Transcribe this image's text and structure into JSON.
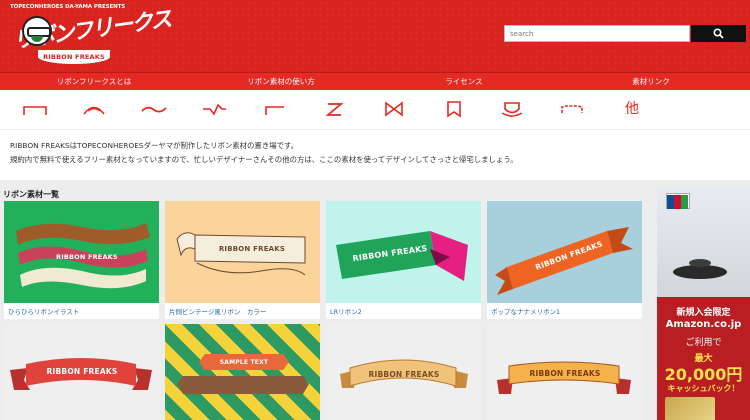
{
  "header": {
    "presents": "TOPECONHEROES DA-YAMA PRESENTS",
    "logo_title": "リボンフリークス",
    "logo_ribbon": "RIBBON FREAKS"
  },
  "search": {
    "placeholder": "search"
  },
  "nav": [
    {
      "label": "リボンフリークスとは"
    },
    {
      "label": "リボン素材の使い方"
    },
    {
      "label": "ライセンス"
    },
    {
      "label": "素材リンク"
    }
  ],
  "ribbon_icons": [
    "ribbon-style-1-icon",
    "ribbon-style-2-icon",
    "ribbon-style-3-icon",
    "ribbon-style-4-icon",
    "ribbon-style-5-icon",
    "ribbon-style-6-icon",
    "ribbon-style-7-icon",
    "ribbon-style-8-icon",
    "ribbon-style-9-icon",
    "ribbon-style-10-icon",
    "ribbon-style-11-icon"
  ],
  "ribbon_icon_other": "他",
  "description": {
    "line1": "RIBBON FREAKSはTOPECONHEROESダーヤマが制作したリボン素材の置き場です。",
    "line2": "規約内で無料で使えるフリー素材となっていますので、忙しいデザイナーさんその他の方は、ここの素材を使ってデザインしてさっさと帰宅しましょう。"
  },
  "section": {
    "title": "リボン素材一覧"
  },
  "cards": [
    {
      "caption": "ひらひらリボンイラスト",
      "ribbon_text": "RIBBON FREAKS",
      "bg": "#22b15a"
    },
    {
      "caption": "片側ビンテージ風リボン　カラー",
      "ribbon_text": "RIBBON FREAKS",
      "bg": "#fbd49b"
    },
    {
      "caption": "LRリボン2",
      "ribbon_text": "RIBBON FREAKS",
      "bg": "#bff3ec"
    },
    {
      "caption": "ポップなナナメリボン1",
      "ribbon_text": "RIBBON FREAKS",
      "bg": "#a8cfdc"
    },
    {
      "caption": "",
      "ribbon_text": "RIBBON FREAKS",
      "bg": "#efefef"
    },
    {
      "caption": "",
      "ribbon_text": "SAMPLE TEXT",
      "bg": "#f4d23a"
    },
    {
      "caption": "",
      "ribbon_text": "RIBBON FREAKS",
      "bg": "#efefef"
    },
    {
      "caption": "",
      "ribbon_text": "RIBBON FREAKS",
      "bg": "#efefef"
    }
  ],
  "ad": {
    "line1": "新規入会限定",
    "line2": "Amazon.co.jp",
    "line3": "ご利用で",
    "line4": "最大",
    "line5": "20,000円",
    "line6": "キャッシュバック！"
  },
  "colors": {
    "brand_red": "#d8231f",
    "nav_red": "#e52a23",
    "link_blue": "#2a6aa8"
  }
}
